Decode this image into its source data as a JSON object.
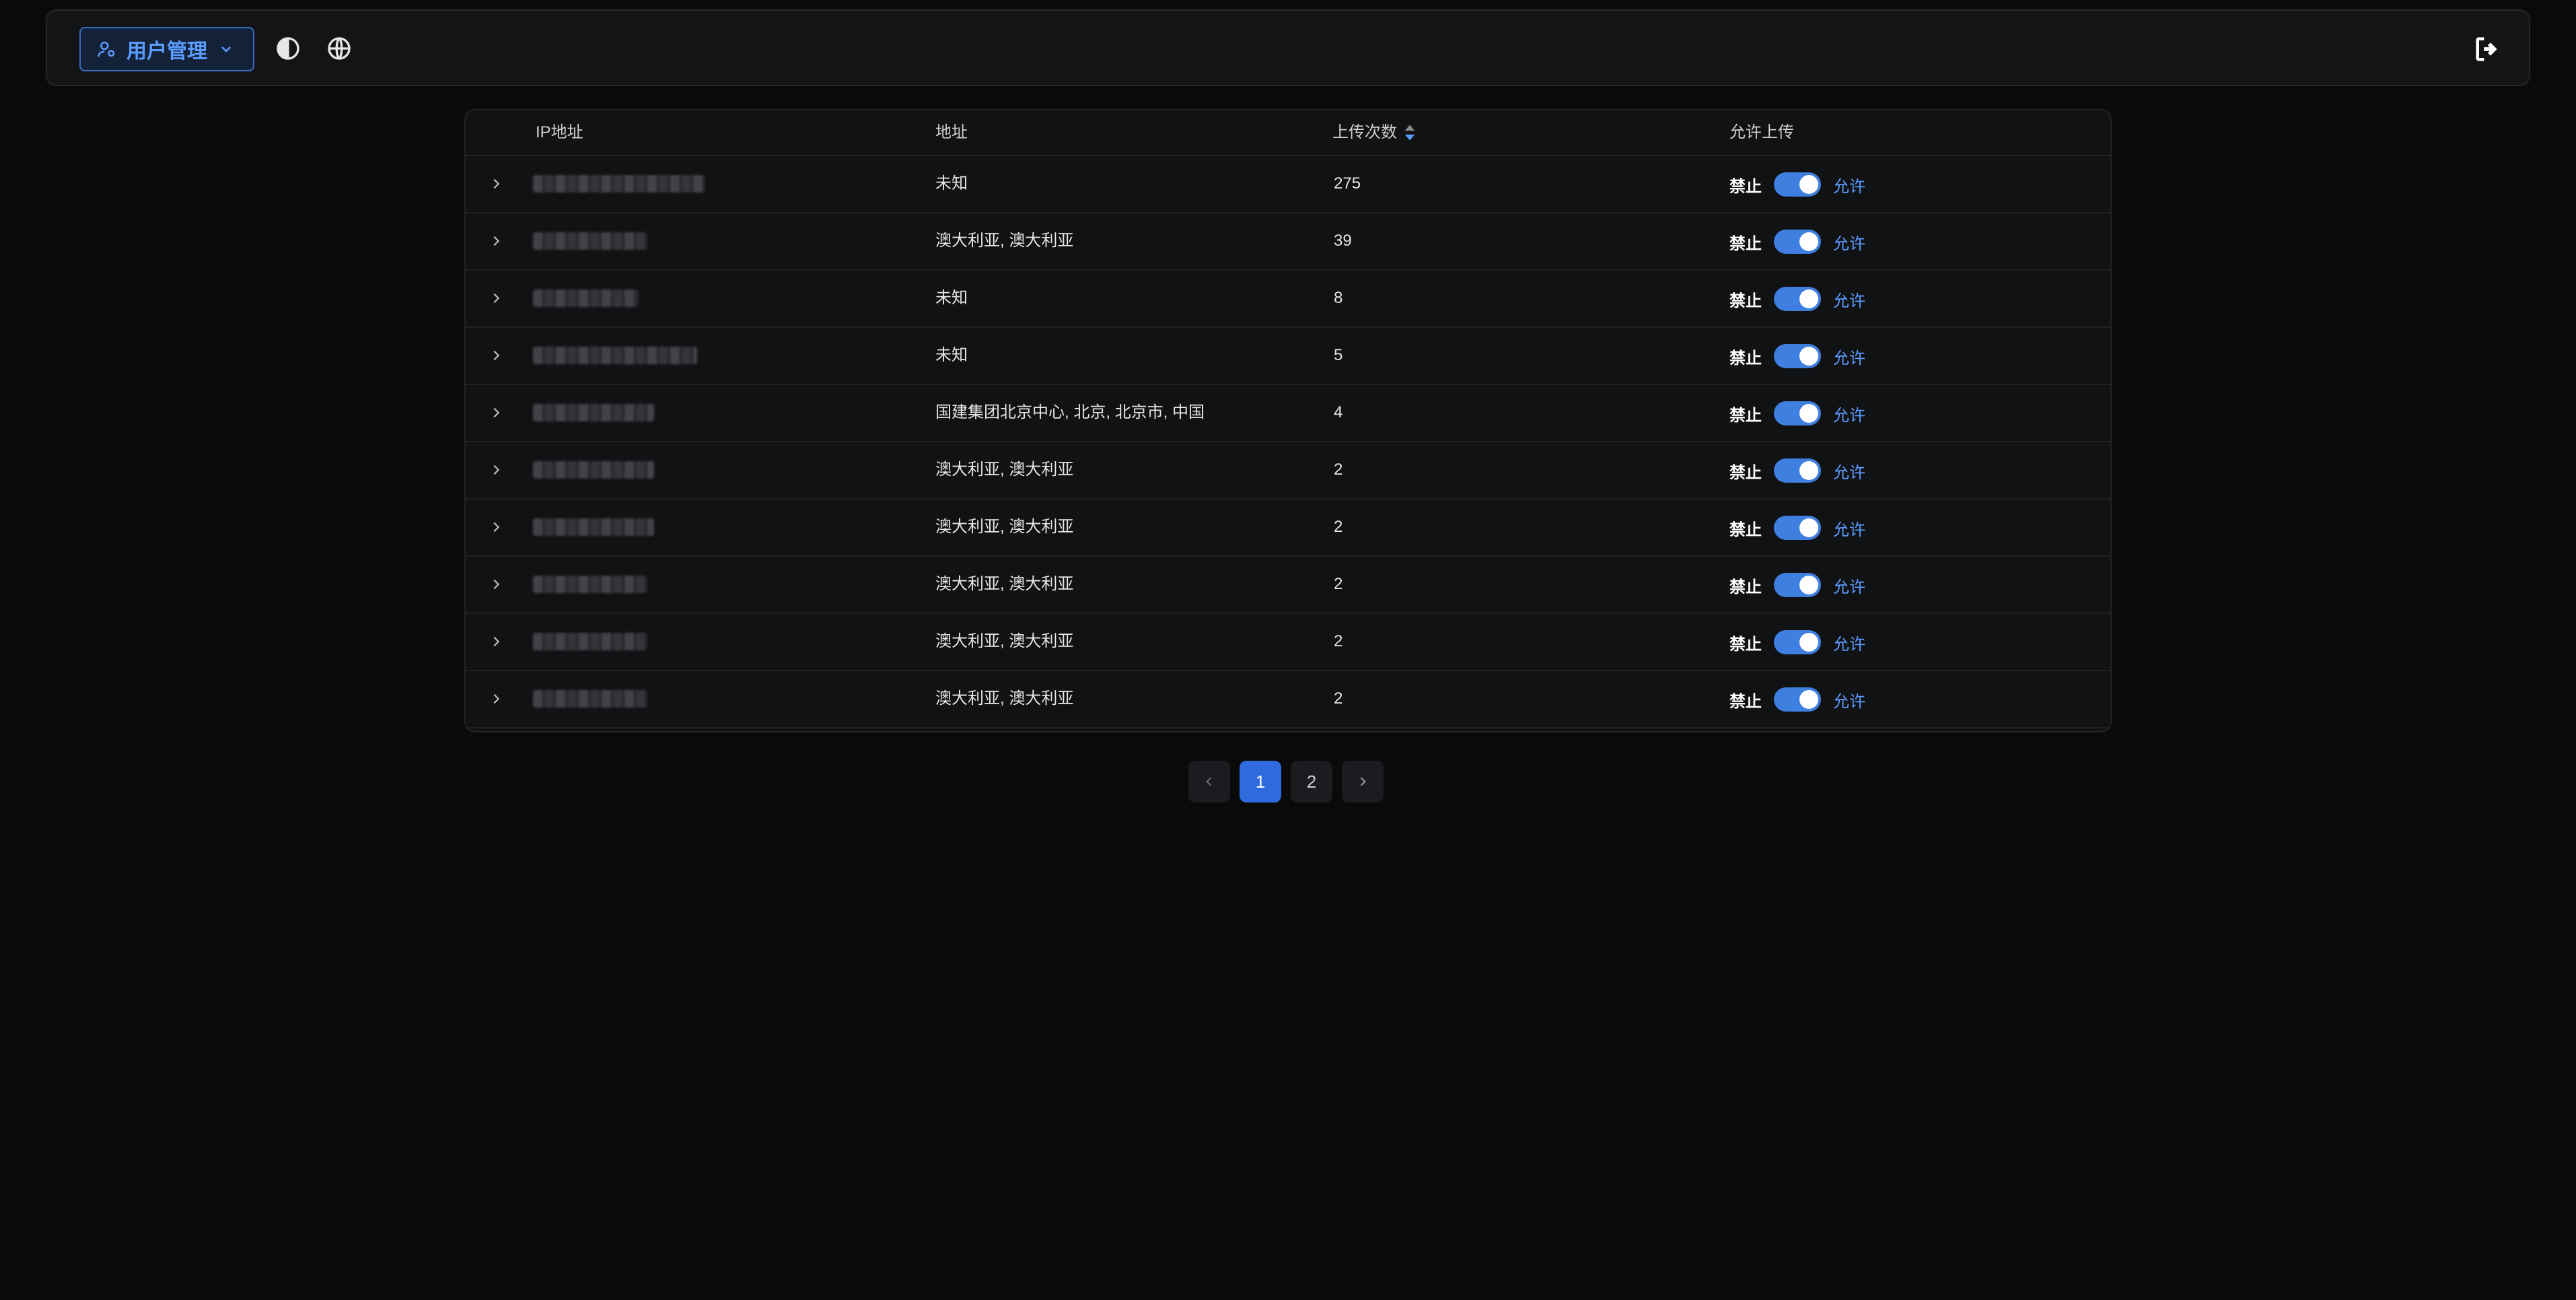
{
  "header": {
    "menu_label": "用户管理",
    "menu_icon": "user-gear-icon",
    "theme_icon": "contrast-icon",
    "lang_icon": "globe-icon",
    "logout_icon": "logout-icon"
  },
  "table": {
    "columns": {
      "ip": "IP地址",
      "address": "地址",
      "count": "上传次数",
      "allow": "允许上传"
    },
    "deny_label": "禁止",
    "allow_label": "允许",
    "rows": [
      {
        "address": "未知",
        "count": "275",
        "allowed": true
      },
      {
        "address": "澳大利亚, 澳大利亚",
        "count": "39",
        "allowed": true
      },
      {
        "address": "未知",
        "count": "8",
        "allowed": true
      },
      {
        "address": "未知",
        "count": "5",
        "allowed": true
      },
      {
        "address": "国建集团北京中心, 北京, 北京市, 中国",
        "count": "4",
        "allowed": true
      },
      {
        "address": "澳大利亚, 澳大利亚",
        "count": "2",
        "allowed": true
      },
      {
        "address": "澳大利亚, 澳大利亚",
        "count": "2",
        "allowed": true
      },
      {
        "address": "澳大利亚, 澳大利亚",
        "count": "2",
        "allowed": true
      },
      {
        "address": "澳大利亚, 澳大利亚",
        "count": "2",
        "allowed": true
      },
      {
        "address": "澳大利亚, 澳大利亚",
        "count": "2",
        "allowed": true
      }
    ]
  },
  "pagination": {
    "pages": [
      "1",
      "2"
    ],
    "current": "1"
  },
  "colors": {
    "accent": "#3f7fe0",
    "background": "#0a0a0a",
    "link": "#5b9cff"
  }
}
